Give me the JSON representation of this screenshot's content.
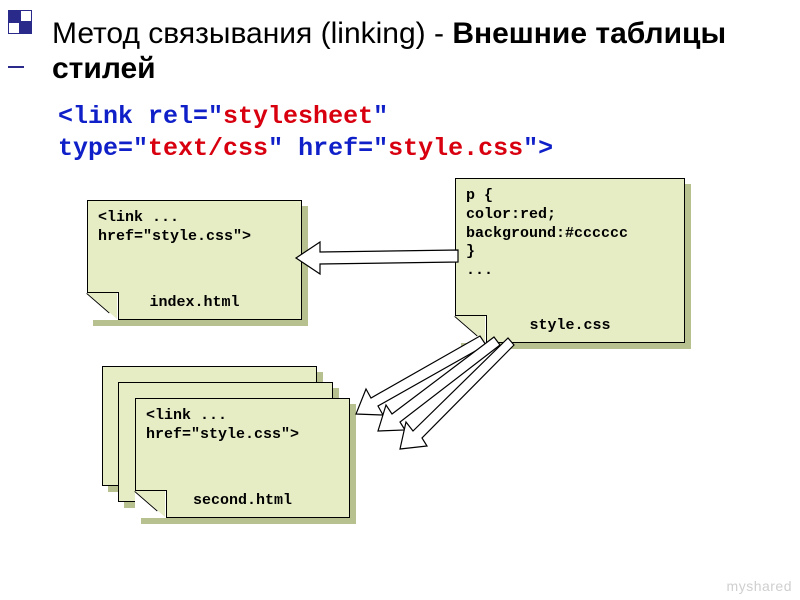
{
  "title": {
    "part1": "Метод связывания (linking) - ",
    "part2": "Внешние таблицы стилей"
  },
  "code": {
    "open": "<link ",
    "rel_k": "rel=",
    "q": "\"",
    "rel_v": "stylesheet",
    "type_k": "type=",
    "type_v": "text/css",
    "sp": " ",
    "href_k": "href=",
    "href_v": "style.css",
    "close": ">"
  },
  "box_index": {
    "line1": "<link ...",
    "line2": "href=\"style.css\">",
    "label": "index.html"
  },
  "box_second": {
    "line1": "<link ...",
    "line2": "href=\"style.css\">",
    "label": "second.html"
  },
  "box_style": {
    "line1": "p {",
    "line2": "color:red;",
    "line3": "background:#cccccc",
    "line4": "}",
    "line5": "...",
    "label": "style.css"
  },
  "watermark": "myshared"
}
